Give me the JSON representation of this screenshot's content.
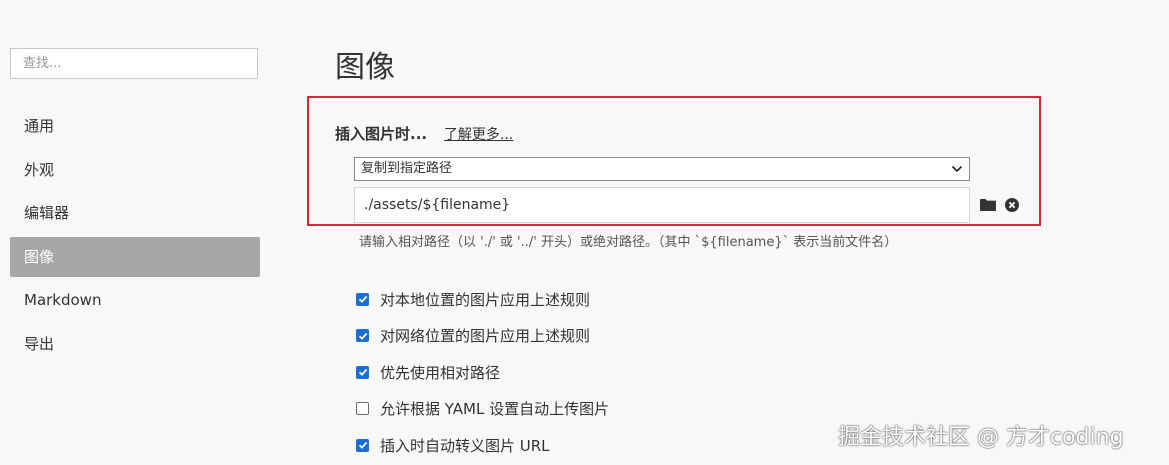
{
  "search": {
    "placeholder": "查找..."
  },
  "sidebar": {
    "items": [
      {
        "label": "通用",
        "active": false
      },
      {
        "label": "外观",
        "active": false
      },
      {
        "label": "编辑器",
        "active": false
      },
      {
        "label": "图像",
        "active": true
      },
      {
        "label": "Markdown",
        "active": false
      },
      {
        "label": "导出",
        "active": false
      }
    ]
  },
  "main": {
    "title": "图像",
    "insert_label": "插入图片时...",
    "learn_more": "了解更多...",
    "select_value": "复制到指定路径",
    "path_value": "./assets/${filename}",
    "hint": "请输入相对路径（以 './' 或 '../' 开头）或绝对路径。（其中 `${filename}` 表示当前文件名）",
    "checkboxes": [
      {
        "label": "对本地位置的图片应用上述规则",
        "checked": true
      },
      {
        "label": "对网络位置的图片应用上述规则",
        "checked": true
      },
      {
        "label": "优先使用相对路径",
        "checked": true
      },
      {
        "label": "允许根据 YAML 设置自动上传图片",
        "checked": false
      },
      {
        "label": "插入时自动转义图片 URL",
        "checked": true
      }
    ]
  },
  "watermark": "掘金技术社区 @ 方才coding",
  "colors": {
    "highlight": "#d22b35",
    "checkbox": "#1a6fd6",
    "active_nav": "#a7a7a7"
  },
  "icons": [
    "chevron-down-icon",
    "folder-icon",
    "clear-icon",
    "checkmark-icon"
  ]
}
